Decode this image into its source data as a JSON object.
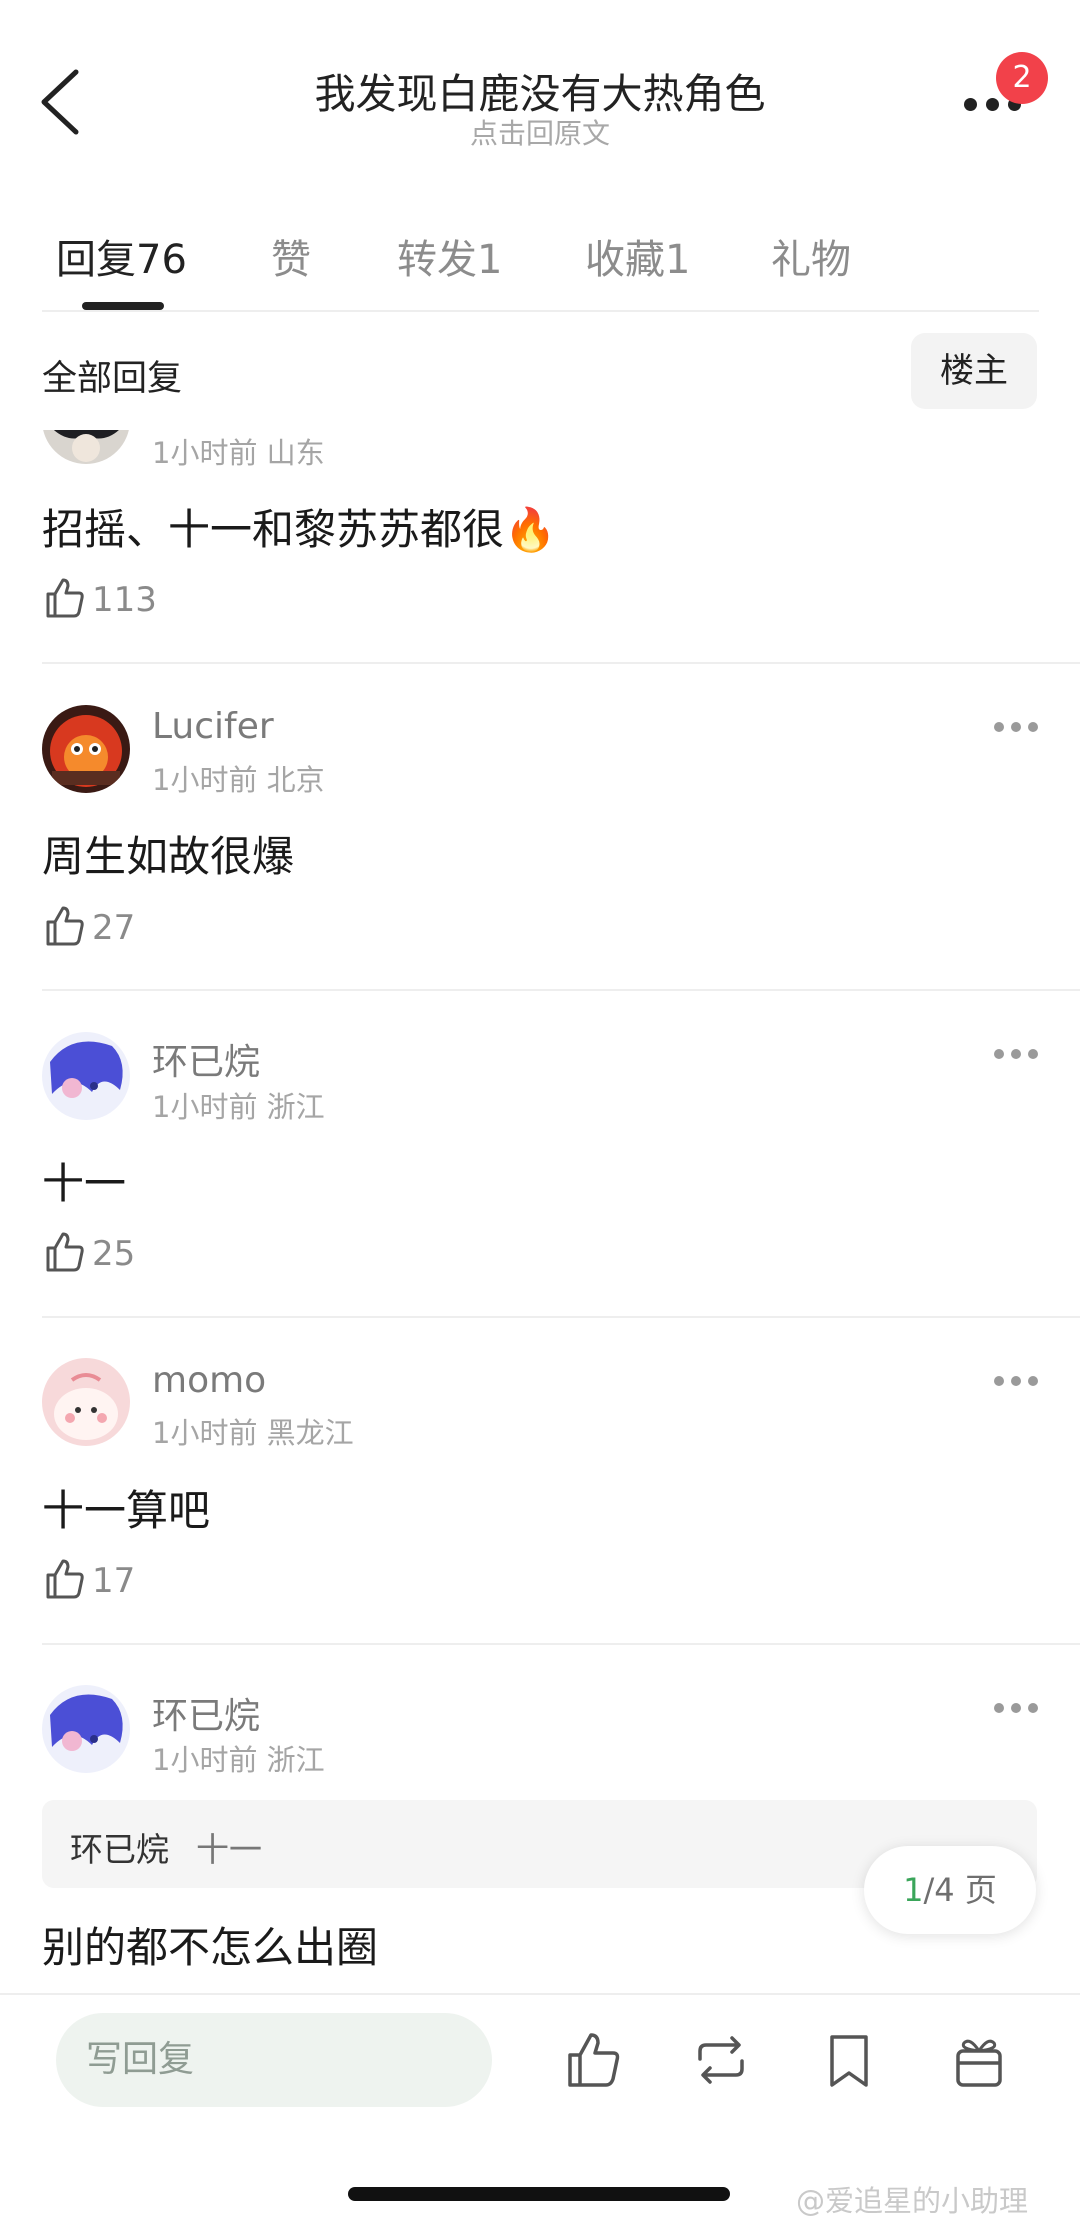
{
  "nav": {
    "title": "我发现白鹿没有大热角色",
    "subtitle": "点击回原文",
    "badge": "2"
  },
  "tabs": [
    {
      "label": "回复",
      "count": "76",
      "active": true
    },
    {
      "label": "赞",
      "count": "",
      "active": false
    },
    {
      "label": "转发",
      "count": "1",
      "active": false
    },
    {
      "label": "收藏",
      "count": "1",
      "active": false
    },
    {
      "label": "礼物",
      "count": "",
      "active": false
    }
  ],
  "filter": {
    "label": "全部回复",
    "owner_button": "楼主"
  },
  "comments": [
    {
      "user": "",
      "time": "1小时前",
      "location": "山东",
      "text": "招摇、十一和黎苏苏都很🔥",
      "likes": "113"
    },
    {
      "user": "Lucifer",
      "time": "1小时前",
      "location": "北京",
      "text": "周生如故很爆",
      "likes": "27"
    },
    {
      "user": "环已烷",
      "time": "1小时前",
      "location": "浙江",
      "text": "十一",
      "likes": "25"
    },
    {
      "user": "momo",
      "time": "1小时前",
      "location": "黑龙江",
      "text": "十一算吧",
      "likes": "17"
    },
    {
      "user": "环已烷",
      "time": "1小时前",
      "location": "浙江",
      "text": "别的都不怎么出圈",
      "quote_user": "环已烷",
      "quote_text": "十一"
    }
  ],
  "pagination": {
    "current": "1",
    "total": "/4 页"
  },
  "bottom_bar": {
    "reply_placeholder": "写回复",
    "icons": [
      "like-icon",
      "repost-icon",
      "bookmark-icon",
      "gift-icon"
    ]
  },
  "watermark": "@爱追星的小助理",
  "colors": {
    "accent_green": "#3aa55a",
    "badge_red": "#f2414a"
  }
}
